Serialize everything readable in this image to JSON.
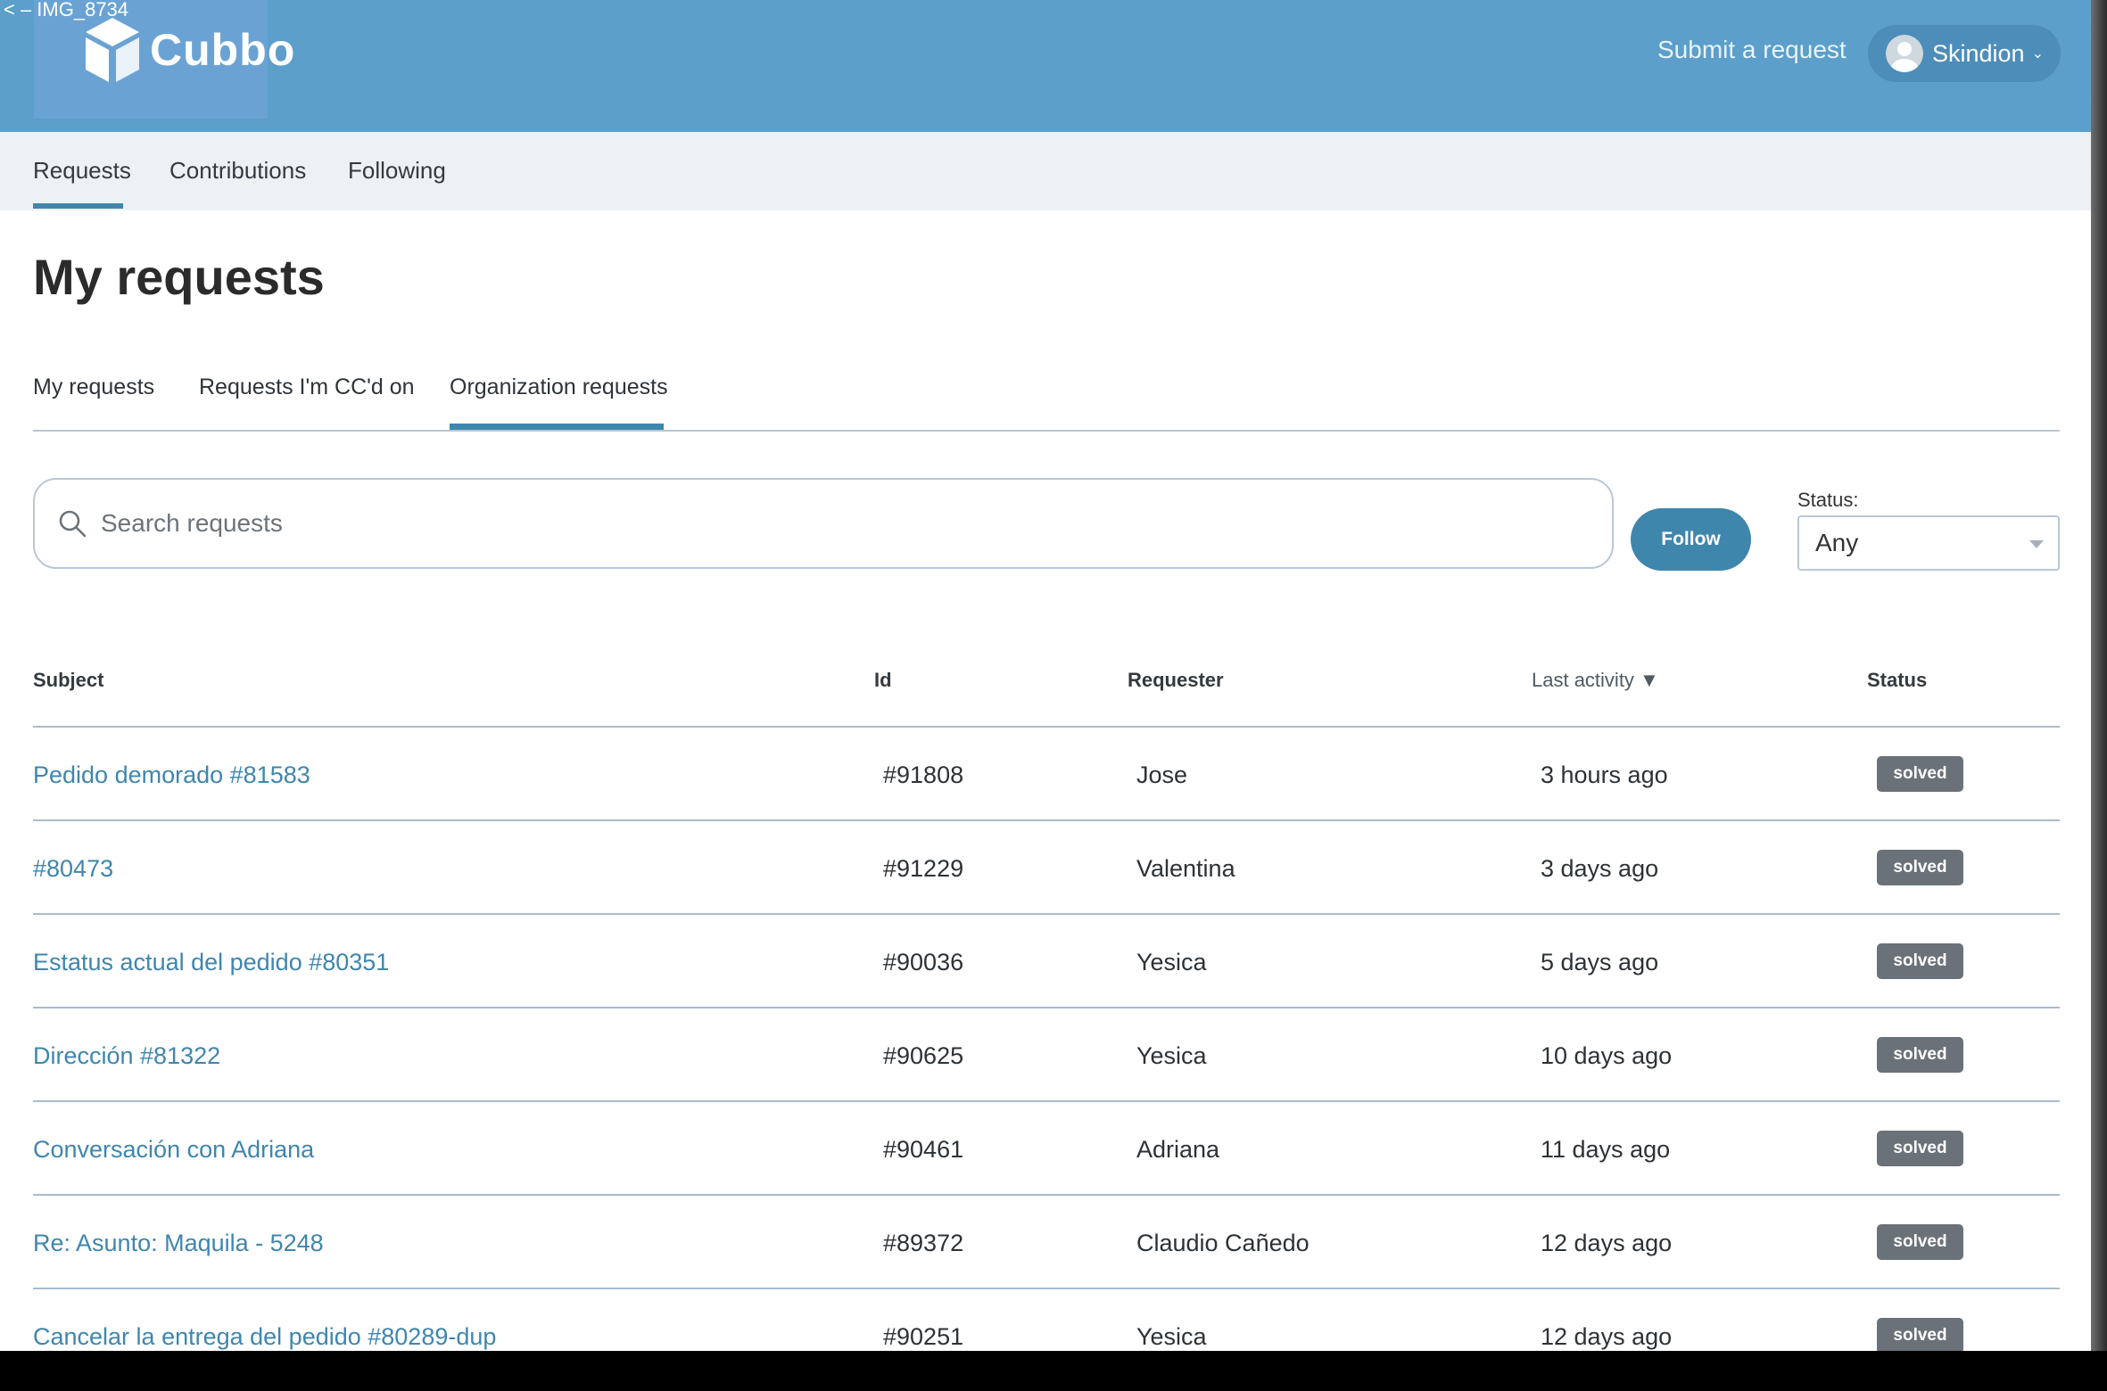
{
  "window_title": "< – IMG_8734",
  "header": {
    "logo_text": "Cubbo",
    "submit_request": "Submit a request",
    "user_name": "Skindion",
    "user_chevron": "⌄",
    "color": "#5b9fca"
  },
  "subnav": {
    "items": [
      "Requests",
      "Contributions",
      "Following"
    ],
    "active": "Requests"
  },
  "page_title": "My requests",
  "tabs": {
    "items": [
      "My requests",
      "Requests I'm CC'd on",
      "Organization requests"
    ],
    "active": "Organization requests"
  },
  "search": {
    "placeholder": "Search requests",
    "value": ""
  },
  "follow_label": "Follow",
  "status_filter": {
    "label": "Status:",
    "selected": "Any"
  },
  "table": {
    "columns": {
      "subject": "Subject",
      "id": "Id",
      "requester": "Requester",
      "last_activity": "Last activity ▼",
      "status": "Status"
    },
    "rows": [
      {
        "subject": "Pedido demorado #81583",
        "id": "#91808",
        "requester": "Jose",
        "last_activity": "3 hours ago",
        "status": "solved"
      },
      {
        "subject": "#80473",
        "id": "#91229",
        "requester": "Valentina",
        "last_activity": "3 days ago",
        "status": "solved"
      },
      {
        "subject": "Estatus actual del pedido #80351",
        "id": "#90036",
        "requester": "Yesica",
        "last_activity": "5 days ago",
        "status": "solved"
      },
      {
        "subject": "Dirección #81322",
        "id": "#90625",
        "requester": "Yesica",
        "last_activity": "10 days ago",
        "status": "solved"
      },
      {
        "subject": "Conversación con Adriana",
        "id": "#90461",
        "requester": "Adriana",
        "last_activity": "11 days ago",
        "status": "solved"
      },
      {
        "subject": "Re: Asunto: Maquila - 5248",
        "id": "#89372",
        "requester": "Claudio Cañedo",
        "last_activity": "12 days ago",
        "status": "solved"
      },
      {
        "subject": "Cancelar la entrega del pedido #80289-dup",
        "id": "#90251",
        "requester": "Yesica",
        "last_activity": "12 days ago",
        "status": "solved"
      }
    ]
  },
  "colors": {
    "accent": "#3f86ad",
    "badge": "#6b7178"
  }
}
